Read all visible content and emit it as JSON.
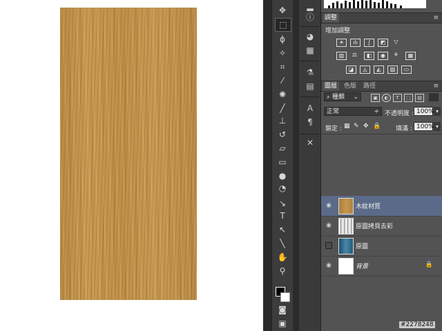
{
  "adjustments": {
    "panel_tab": "調整",
    "add_label": "增加調整"
  },
  "layers_panel": {
    "tabs": [
      "圖層",
      "色版",
      "路徑"
    ],
    "kind_filter": "種類",
    "blend_mode": "正常",
    "opacity_label": "不透明度 :",
    "opacity_value": "100%",
    "lock_label": "鎖定 :",
    "fill_label": "填滿 :",
    "fill_value": "100%",
    "layers": [
      {
        "name": "木紋材質",
        "visible": true,
        "active": true
      },
      {
        "name": "原圖拷貝去彩",
        "visible": true,
        "active": false
      },
      {
        "name": "原圖",
        "visible": false,
        "active": false
      },
      {
        "name": "背景",
        "visible": true,
        "active": false,
        "locked": true
      }
    ]
  },
  "watermark": "#2278248",
  "colors": {
    "panel_bg": "#535353",
    "active_layer": "#5a6a88",
    "wood": "#c0924b"
  }
}
